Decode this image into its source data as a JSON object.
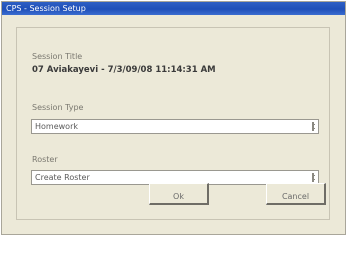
{
  "window": {
    "title": "CPS - Session Setup"
  },
  "session_title": {
    "label": "Session Title",
    "value": "07 Aviakayevi - 7/3/09/08 11:14:31 AM"
  },
  "session_type": {
    "label": "Session Type",
    "selected": "Homework"
  },
  "roster": {
    "label": "Roster",
    "selected": "Create Roster"
  },
  "buttons": {
    "ok_label": "Ok",
    "cancel_label": "Cancel"
  },
  "icons": {
    "dropdown": "chevron-down-icon"
  }
}
